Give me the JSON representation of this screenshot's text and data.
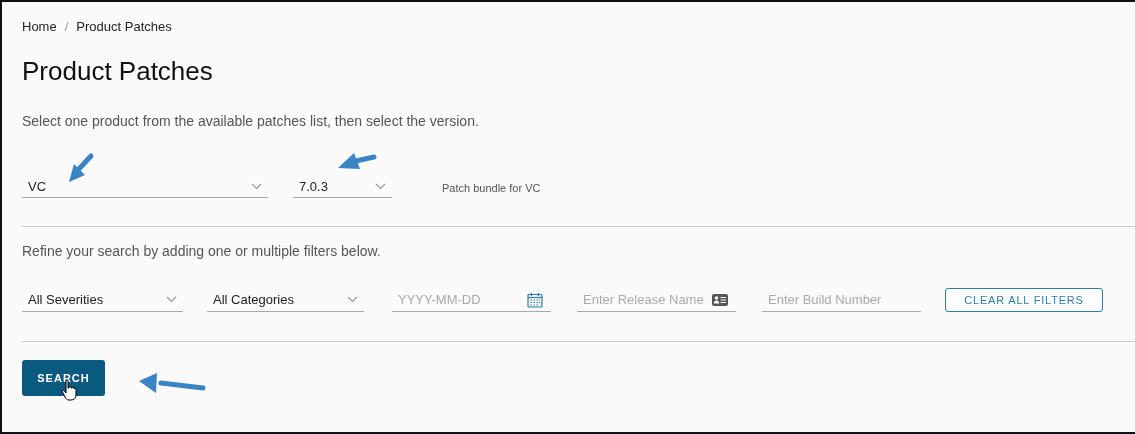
{
  "breadcrumb": [
    "Home",
    "Product Patches"
  ],
  "breadcrumb_separator": "/",
  "title": "Product Patches",
  "description": "Select one product from the available patches list, then select the version.",
  "product_select": {
    "value": "VC"
  },
  "version_select": {
    "value": "7.0.3"
  },
  "selection_hint": "Patch bundle for VC",
  "filter_hint": "Refine your search by adding one or multiple filters below.",
  "filters": [
    {
      "kind": "select",
      "value": "All Severities"
    },
    {
      "kind": "select",
      "value": "All Categories"
    },
    {
      "kind": "date",
      "placeholder": "YYYY-MM-DD"
    },
    {
      "kind": "card",
      "placeholder": "Enter Release Name"
    },
    {
      "kind": "text",
      "placeholder": "Enter Build Number"
    }
  ],
  "clear_button": "CLEAR ALL FILTERS",
  "search_button": "SEARCH"
}
